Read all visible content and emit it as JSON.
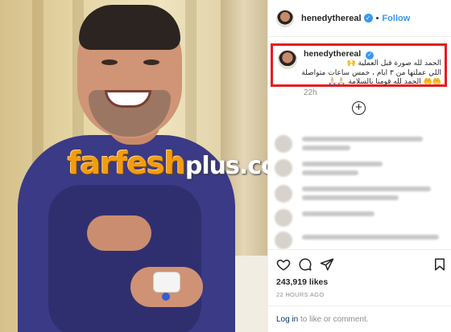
{
  "watermark": {
    "main": "farfesh",
    "suffix": "plus.com"
  },
  "post": {
    "username": "henedythereal",
    "follow_label": "Follow",
    "separator": "•",
    "verified_icon": "verified-badge-icon",
    "caption": {
      "username": "henedythereal",
      "line1": "الحمد لله صورة قبل العملية 🙌",
      "line2": "اللي عملتها من ٣ ايام ، خمس ساعات متواصلة",
      "line3": "🤲🤲 الحمد لله قومنا بالسلامة 🙏🏻🙏🏻"
    },
    "time_short": "22h",
    "likes": "243,919 likes",
    "time_ago": "22 HOURS AGO",
    "login_link": "Log in",
    "login_suffix": " to like or comment."
  },
  "colors": {
    "accent": "#3897f0",
    "highlight_border": "#e51b1b",
    "gown": "#3a3a86",
    "watermark": "#f39c12"
  },
  "icons": [
    "heart-icon",
    "comment-icon",
    "share-icon",
    "bookmark-icon",
    "add-comment-icon"
  ]
}
